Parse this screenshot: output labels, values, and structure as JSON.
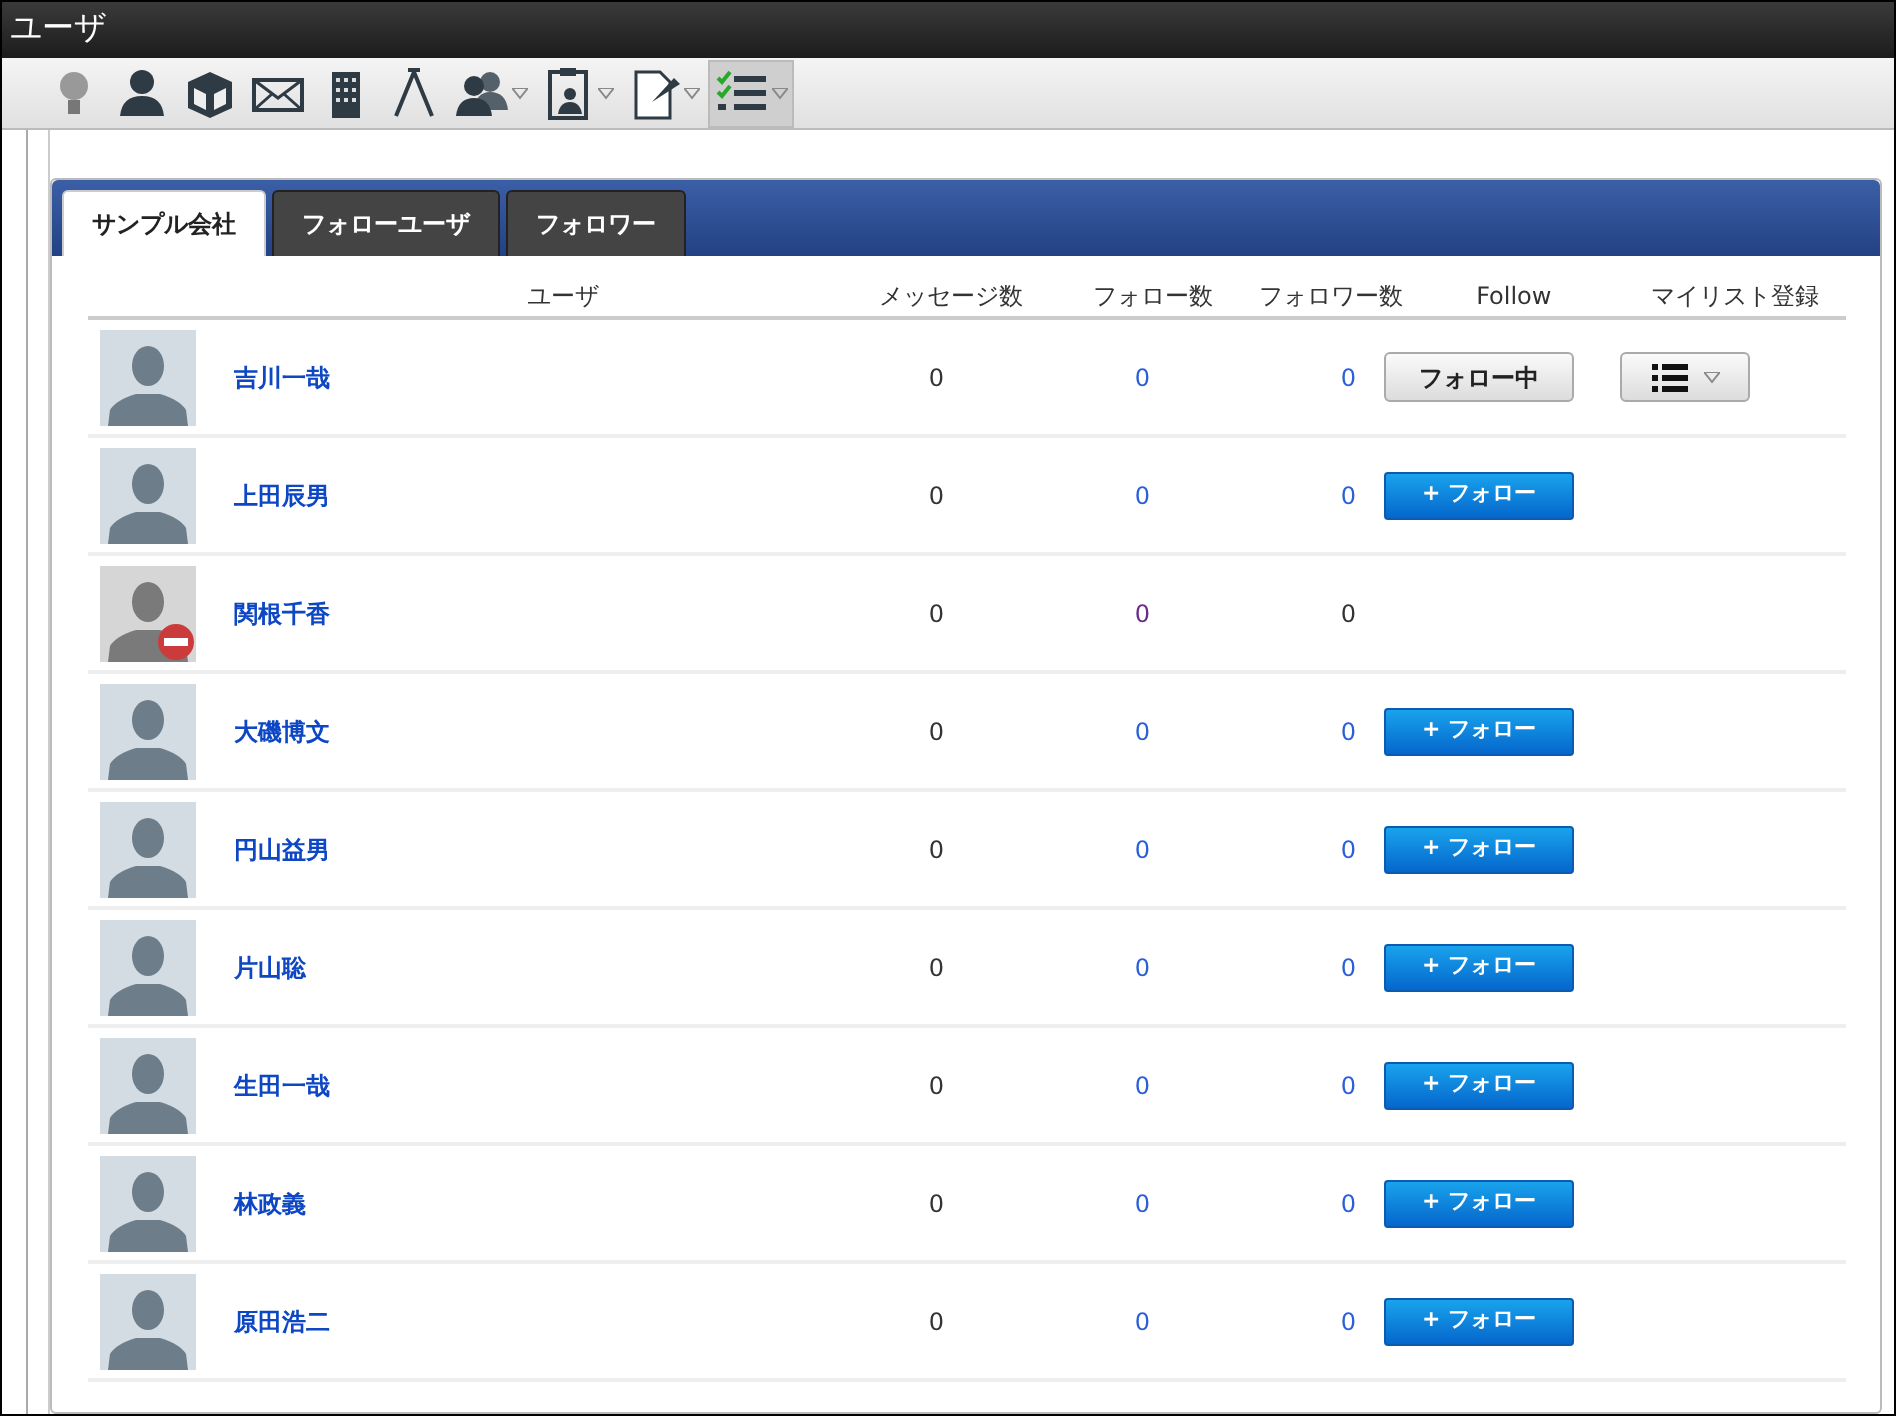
{
  "window": {
    "title": "ユーザ"
  },
  "toolbar": [
    {
      "kind": "bulb",
      "dropdown": false,
      "selected": false
    },
    {
      "kind": "person",
      "dropdown": false,
      "selected": false
    },
    {
      "kind": "box",
      "dropdown": false,
      "selected": false
    },
    {
      "kind": "mail",
      "dropdown": false,
      "selected": false
    },
    {
      "kind": "building",
      "dropdown": false,
      "selected": false
    },
    {
      "kind": "compass",
      "dropdown": false,
      "selected": false
    },
    {
      "kind": "people",
      "dropdown": true,
      "selected": false
    },
    {
      "kind": "clipboard",
      "dropdown": true,
      "selected": false
    },
    {
      "kind": "document",
      "dropdown": true,
      "selected": false
    },
    {
      "kind": "checklist",
      "dropdown": true,
      "selected": true
    }
  ],
  "tabs": [
    {
      "label": "サンプル会社",
      "selected": true
    },
    {
      "label": "フォローユーザ",
      "selected": false
    },
    {
      "label": "フォロワー",
      "selected": false
    }
  ],
  "table": {
    "columns": [
      "ユーザ",
      "メッセージ数",
      "フォロー数",
      "フォロワー数",
      "Follow",
      "マイリスト登録"
    ],
    "rows": [
      {
        "name": "吉川一哉",
        "disabled": false,
        "messages": "0",
        "follows": "0",
        "followers": "0",
        "follow": {
          "kind": "following",
          "label": "フォロー中"
        },
        "mylist": true
      },
      {
        "name": "上田辰男",
        "disabled": false,
        "messages": "0",
        "follows": "0",
        "followers": "0",
        "follow": {
          "kind": "follow",
          "label": "+ フォロー"
        },
        "mylist": false
      },
      {
        "name": "関根千香",
        "disabled": true,
        "messages": "0",
        "follows": "0",
        "followers": "0",
        "mylist": false
      },
      {
        "name": "大磯博文",
        "disabled": false,
        "messages": "0",
        "follows": "0",
        "followers": "0",
        "follow": {
          "kind": "follow",
          "label": "+ フォロー"
        },
        "mylist": false
      },
      {
        "name": "円山益男",
        "disabled": false,
        "messages": "0",
        "follows": "0",
        "followers": "0",
        "follow": {
          "kind": "follow",
          "label": "+ フォロー"
        },
        "mylist": false
      },
      {
        "name": "片山聡",
        "disabled": false,
        "messages": "0",
        "follows": "0",
        "followers": "0",
        "follow": {
          "kind": "follow",
          "label": "+ フォロー"
        },
        "mylist": false
      },
      {
        "name": "生田一哉",
        "disabled": false,
        "messages": "0",
        "follows": "0",
        "followers": "0",
        "follow": {
          "kind": "follow",
          "label": "+ フォロー"
        },
        "mylist": false
      },
      {
        "name": "林政義",
        "disabled": false,
        "messages": "0",
        "follows": "0",
        "followers": "0",
        "follow": {
          "kind": "follow",
          "label": "+ フォロー"
        },
        "mylist": false
      },
      {
        "name": "原田浩二",
        "disabled": false,
        "messages": "0",
        "follows": "0",
        "followers": "0",
        "follow": {
          "kind": "follow",
          "label": "+ フォロー"
        },
        "mylist": false
      }
    ]
  }
}
